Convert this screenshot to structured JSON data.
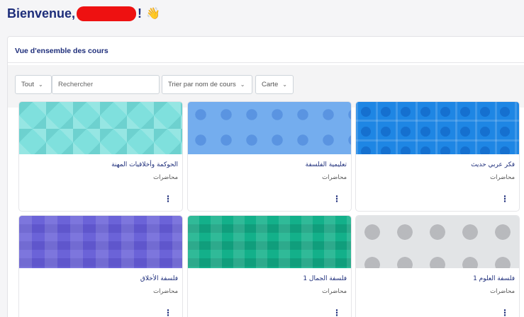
{
  "greeting": {
    "prefix": "Bienvenue,",
    "suffix": "!",
    "wave_icon": "waving-hand-icon"
  },
  "block": {
    "title": "Vue d'ensemble des cours"
  },
  "controls": {
    "filter": "Tout",
    "search_placeholder": "Rechercher",
    "sort": "Trier par nom de cours",
    "view": "Carte"
  },
  "courses": [
    {
      "title": "الحوكمة وأخلاقيات المهنة",
      "category": "محاضرات"
    },
    {
      "title": "تعليمية الفلسفة",
      "category": "محاضرات"
    },
    {
      "title": "فكر عربي حديث",
      "category": "محاضرات"
    },
    {
      "title": "فلسفة الأخلاق",
      "category": "محاضرات"
    },
    {
      "title": "فلسفة الجمال 1",
      "category": "محاضرات"
    },
    {
      "title": "فلسفة العلوم 1",
      "category": "محاضرات"
    }
  ],
  "colors": {
    "accent": "#1d2d7a",
    "redaction": "#ee1111"
  }
}
